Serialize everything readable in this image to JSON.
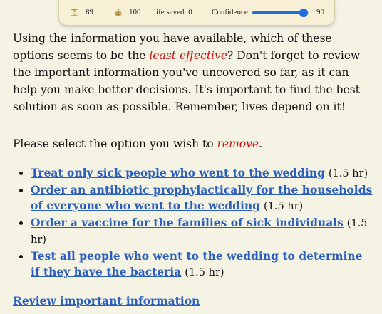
{
  "status": {
    "time": "89",
    "money": "100",
    "lives_label": "life saved: 0",
    "confidence_label": "Confidence:",
    "confidence_value": "90",
    "confidence_fraction": 0.9,
    "icons": {
      "time": "hourglass-icon",
      "money": "moneybag-icon"
    }
  },
  "question": {
    "part1": "Using the information you have available, which of these options seems to be the ",
    "emphasis": "least effective",
    "part2": "? Don't forget to review the important information you've uncovered so far, as it can help you make better decisions. It's important to find the best solution as soon as possible. Remember, lives depend on it!"
  },
  "prompt": {
    "part1": "Please select the option you wish to ",
    "emphasis": "remove",
    "part2": "."
  },
  "options": [
    {
      "label": "Treat only sick people who went to the wedding",
      "time": "(1.5 hr)"
    },
    {
      "label": "Order an antibiotic prophylactically for the households of everyone who went to the wedding",
      "time": "(1.5 hr)"
    },
    {
      "label": "Order a vaccine for the families of sick individuals",
      "time": "(1.5 hr)"
    },
    {
      "label": "Test all people who went to the wedding to determine if they have the bacteria",
      "time": "(1.5 hr)"
    }
  ],
  "review_link": "Review important information",
  "colors": {
    "background": "#f5f3e4",
    "link": "#2b5fbf",
    "emphasis": "#cc1111",
    "slider": "#1f6fe0"
  }
}
